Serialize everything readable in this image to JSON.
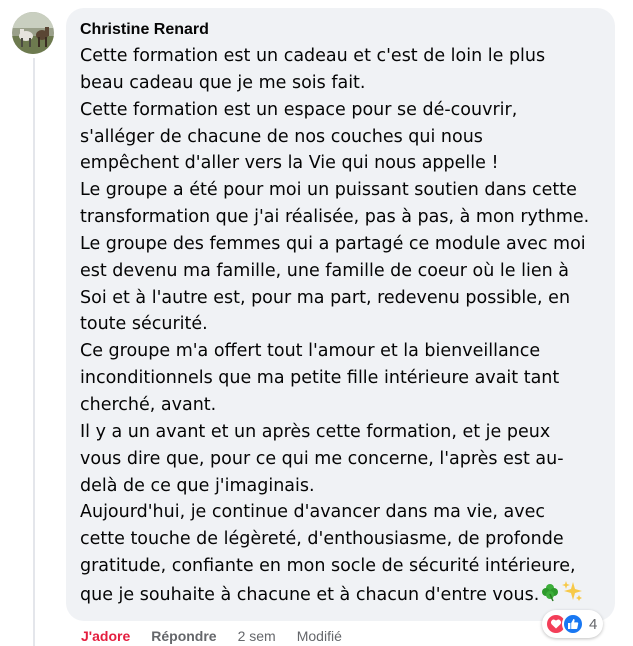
{
  "comment": {
    "author": "Christine Renard",
    "lines": [
      "Cette formation est un cadeau et c'est de loin le plus",
      "beau cadeau que je me sois fait.",
      "Cette formation est un espace pour se dé-couvrir,",
      "s'alléger de chacune de nos couches qui nous",
      "empêchent d'aller vers la Vie qui nous appelle !",
      "Le groupe a été pour moi un puissant soutien dans cette",
      "transformation que j'ai réalisée, pas à pas, à mon rythme.",
      "Le groupe des femmes qui a partagé ce module avec moi",
      "est devenu ma famille, une famille de coeur où le lien à",
      "Soi et à l'autre est, pour ma part, redevenu possible, en",
      "toute sécurité.",
      "Ce groupe m'a offert tout l'amour et la bienveillance",
      "inconditionnels que ma petite fille intérieure avait tant",
      "cherché, avant.",
      "Il y a un avant et un après cette formation, et je peux",
      "vous dire que, pour ce qui me concerne, l'après est au-",
      "delà de ce que j'imaginais.",
      "Aujourd'hui, je continue d'avancer dans ma vie, avec",
      "cette touche de légèreté, d'enthousiasme, de profonde",
      "gratitude, confiante en mon socle de sécurité intérieure,",
      "que je souhaite à chacune et à chacun d'entre vous."
    ],
    "trailing_emojis": [
      "four-leaf-clover",
      "sparkles"
    ]
  },
  "actions": {
    "like_label": "J'adore",
    "reply_label": "Répondre",
    "time": "2 sem",
    "edited_label": "Modifié"
  },
  "reactions": {
    "icons": [
      "love",
      "like"
    ],
    "count": "4"
  },
  "colors": {
    "bubble": "#f0f2f5",
    "love_active": "#e41e3f",
    "muted": "#65676b",
    "like_blue": "#1877f2",
    "love_red": "#f33e58"
  }
}
